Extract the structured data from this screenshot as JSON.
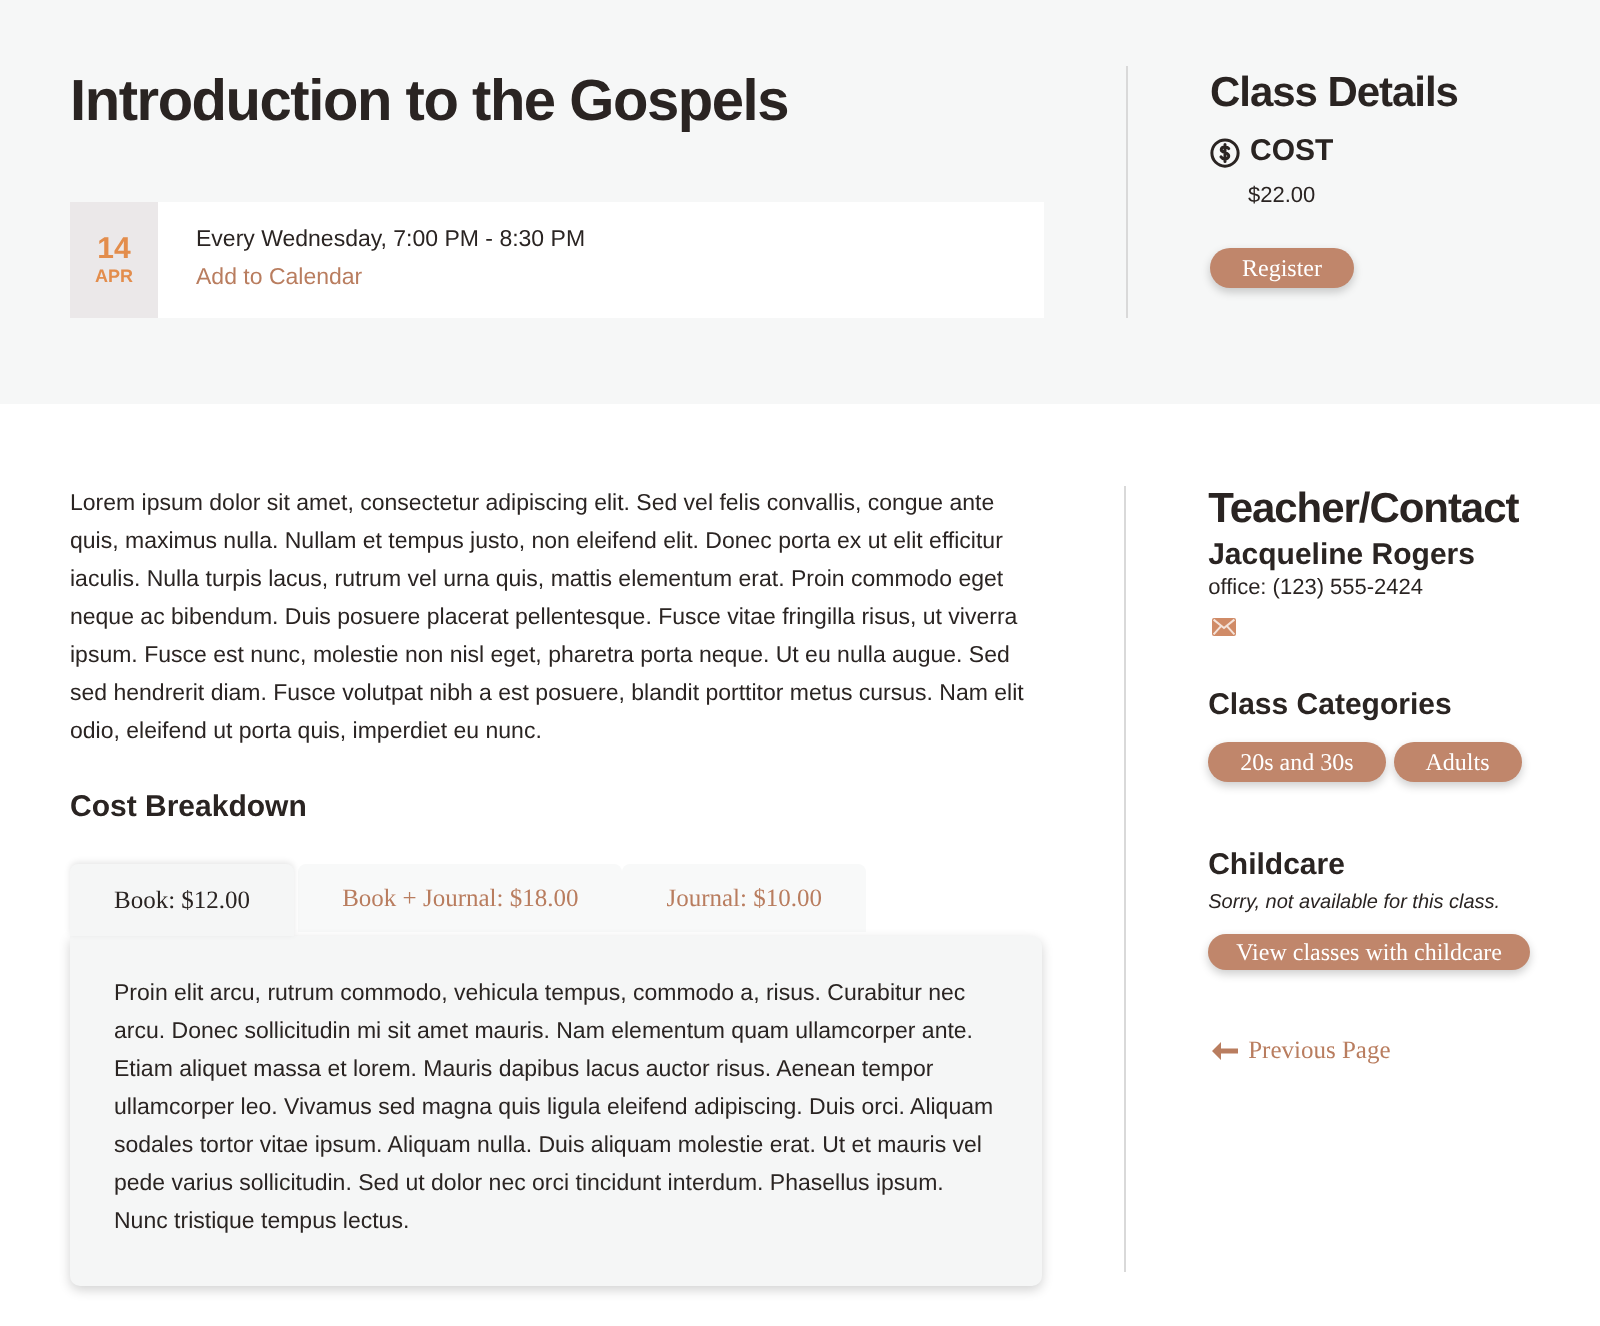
{
  "header": {
    "title": "Introduction to the Gospels",
    "event": {
      "day": "14",
      "month": "APR",
      "schedule": "Every Wednesday, 7:00 PM - 8:30 PM",
      "calendar_link": "Add to Calendar"
    }
  },
  "class_details": {
    "title": "Class Details",
    "cost_label": "COST",
    "cost_value": "$22.00",
    "register_button": "Register"
  },
  "description": "Lorem ipsum dolor sit amet, consectetur adipiscing elit. Sed vel felis convallis, congue ante quis, maximus nulla. Nullam et tempus justo, non eleifend elit. Donec porta ex ut elit efficitur iaculis. Nulla turpis lacus, rutrum vel urna quis, mattis elementum erat. Proin commodo eget neque ac bibendum. Duis posuere placerat pellentesque. Fusce vitae fringilla risus, ut viverra ipsum. Fusce est nunc, molestie non nisl eget, pharetra porta neque. Ut eu nulla augue. Sed sed hendrerit diam. Fusce volutpat nibh a est posuere, blandit porttitor metus cursus. Nam elit odio, eleifend ut porta quis, imperdiet eu nunc.",
  "cost_breakdown": {
    "title": "Cost Breakdown",
    "tabs": [
      {
        "label": "Book: $12.00",
        "selected": true
      },
      {
        "label": "Book + Journal: $18.00",
        "selected": false
      },
      {
        "label": "Journal: $10.00",
        "selected": false
      }
    ],
    "panel_text": "Proin elit arcu, rutrum commodo, vehicula tempus, commodo a, risus. Curabitur nec arcu. Donec sollicitudin mi sit amet mauris. Nam elementum quam ullamcorper ante. Etiam aliquet massa et lorem. Mauris dapibus lacus auctor risus. Aenean tempor ullamcorper leo. Vivamus sed magna quis ligula eleifend adipiscing. Duis orci. Aliquam sodales tortor vitae ipsum. Aliquam nulla. Duis aliquam molestie erat. Ut et mauris vel pede varius sollicitudin. Sed ut dolor nec orci tincidunt interdum. Phasellus ipsum. Nunc tristique tempus lectus."
  },
  "teacher_contact": {
    "title": "Teacher/Contact",
    "name": "Jacqueline Rogers",
    "office": "office: (123) 555-2424"
  },
  "class_categories": {
    "title": "Class Categories",
    "tags": [
      "20s and 30s",
      "Adults"
    ]
  },
  "childcare": {
    "title": "Childcare",
    "note": "Sorry, not available for this class.",
    "button": "View classes with childcare"
  },
  "previous_page": {
    "label": "Previous Page"
  }
}
